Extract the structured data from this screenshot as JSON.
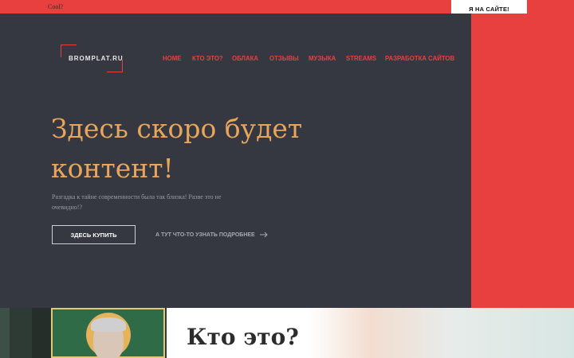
{
  "topbar": {
    "text": "Cool?",
    "cta_label": "Я НА САЙТЕ!"
  },
  "logo": {
    "text": "BROMPLAT.RU"
  },
  "nav": {
    "items": [
      {
        "label": "HOME"
      },
      {
        "label": "КТО ЭТО?"
      },
      {
        "label": "ОБЛАКА"
      },
      {
        "label": "ОТЗЫВЫ"
      },
      {
        "label": "МУЗЫКА"
      },
      {
        "label": "STREAMS"
      },
      {
        "label": "РАЗРАБОТКА САЙТОВ"
      }
    ]
  },
  "hero": {
    "title": "Здесь скоро будет контент!",
    "subtitle": "Разгадка к тайне современности была так близка! Разве это не очевидно!?",
    "buy_button": "ЗДЕСЬ КУПИТЬ",
    "more_link": "А ТУТ ЧТО-ТО УЗНАТЬ ПОДРОБНЕЕ"
  },
  "section": {
    "heading": "Кто это?"
  },
  "icons": {
    "arrow": "arrow-right-icon"
  },
  "colors": {
    "accent": "#e8403e",
    "dark_bg": "#353840",
    "title": "#e8a55c"
  }
}
